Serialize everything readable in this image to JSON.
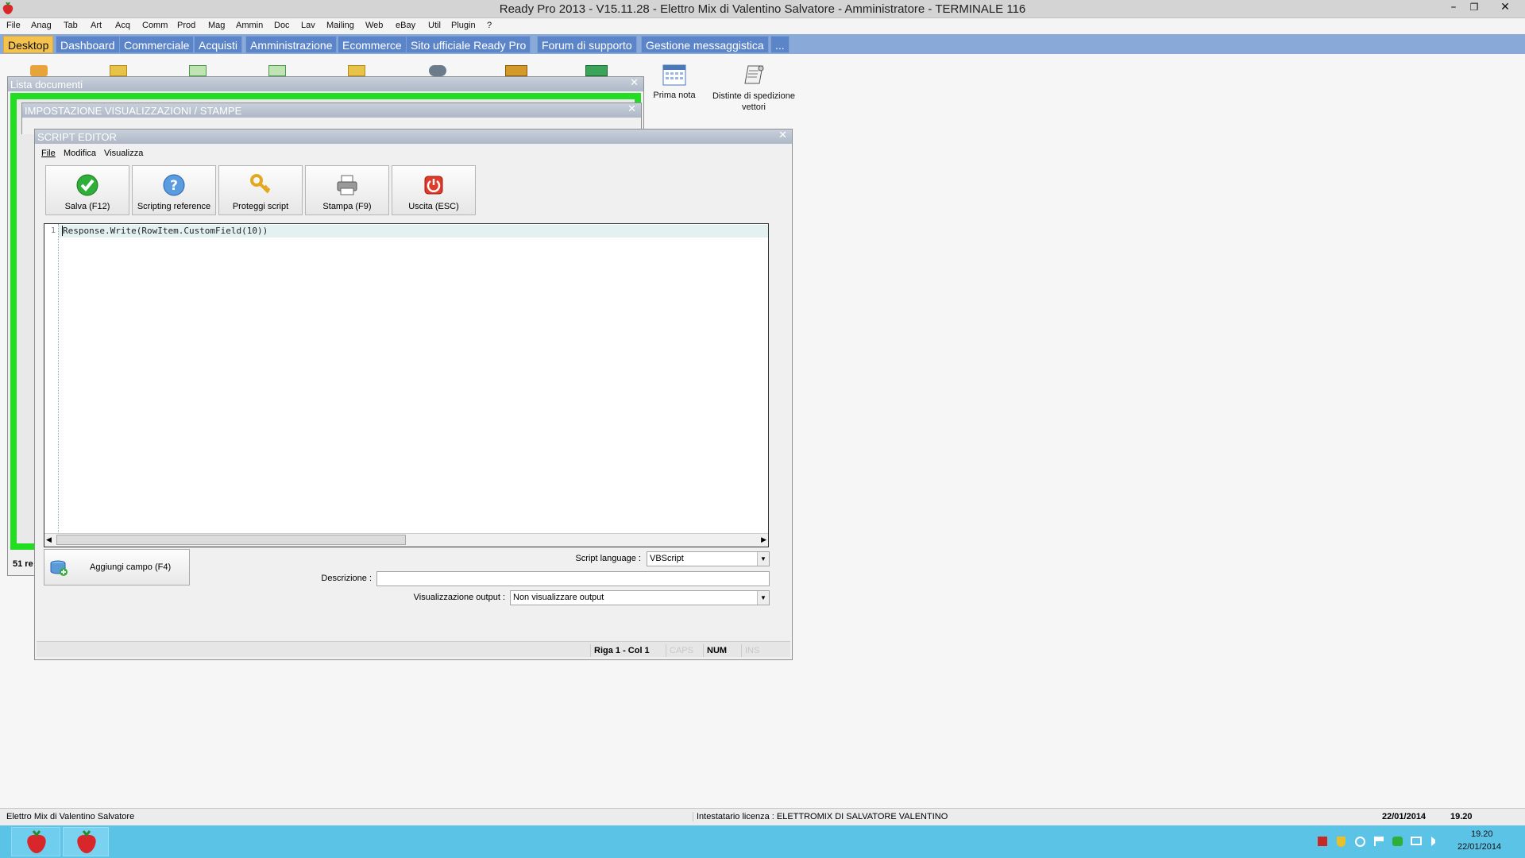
{
  "window": {
    "title": "Ready Pro 2013 - V15.11.28 - Elettro Mix di Valentino Salvatore - Amministratore - TERMINALE 116"
  },
  "menu": [
    "File",
    "Anag",
    "Tab",
    "Art",
    "Acq",
    "Comm",
    "Prod",
    "Mag",
    "Ammin",
    "Doc",
    "Lav",
    "Mailing",
    "Web",
    "eBay",
    "Util",
    "Plugin",
    "?"
  ],
  "tabs": [
    {
      "label": "Desktop",
      "active": true
    },
    {
      "label": "Dashboard"
    },
    {
      "label": "Commerciale"
    },
    {
      "label": "Acquisti"
    },
    {
      "label": "Amministrazione"
    },
    {
      "label": "Ecommerce"
    },
    {
      "label": "Sito ufficiale Ready Pro"
    },
    {
      "label": "Forum di supporto"
    },
    {
      "label": "Gestione messaggistica"
    },
    {
      "label": "..."
    }
  ],
  "desktop_icons": [
    {
      "label": "Prima nota",
      "icon": "calendar-icon"
    },
    {
      "label": "Distinte di spedizione vettori",
      "icon": "scroll-icon"
    }
  ],
  "lista_documenti": {
    "title": "Lista documenti",
    "footer": "51 re"
  },
  "impostazione": {
    "title": "IMPOSTAZIONE VISUALIZZAZIONI / STAMPE"
  },
  "script_editor": {
    "title": "SCRIPT EDITOR",
    "menu": [
      "File",
      "Modifica",
      "Visualizza"
    ],
    "toolbar": [
      {
        "label": "Salva (F12)",
        "icon": "checkmark-icon"
      },
      {
        "label": "Scripting reference",
        "icon": "help-icon"
      },
      {
        "label": "Proteggi script",
        "icon": "key-icon"
      },
      {
        "label": "Stampa (F9)",
        "icon": "printer-icon"
      },
      {
        "label": "Uscita (ESC)",
        "icon": "power-icon"
      }
    ],
    "code": {
      "line_number": "1",
      "text": "Response.Write(RowItem.CustomField(10))"
    },
    "add_field_label": "Aggiungi campo (F4)",
    "script_language": {
      "label": "Script language :",
      "value": "VBScript"
    },
    "descrizione": {
      "label": "Descrizione :",
      "value": ""
    },
    "visualizzazione_output": {
      "label": "Visualizzazione output :",
      "value": "Non visualizzare output"
    },
    "status": {
      "position": "Riga 1 - Col 1",
      "caps": "CAPS",
      "num": "NUM",
      "ins": "INS"
    }
  },
  "statusbar": {
    "company": "Elettro Mix di Valentino Salvatore",
    "license": "Intestatario licenza : ELETTROMIX DI SALVATORE VALENTINO",
    "date": "22/01/2014",
    "time": "19.20"
  },
  "taskbar": {
    "clock_time": "19.20",
    "clock_date": "22/01/2014"
  },
  "colors": {
    "tab_bar": "#89a9d9",
    "tab_active": "#f6c24e",
    "taskbar": "#5bc4e6",
    "green_frame": "#22dd22"
  }
}
